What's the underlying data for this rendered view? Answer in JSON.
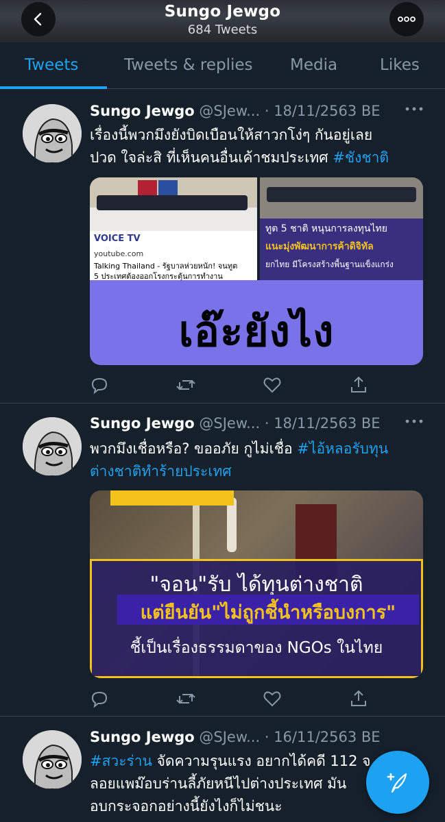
{
  "header": {
    "title": "Sungo Jewgo",
    "subtitle": "684 Tweets"
  },
  "tabs": [
    {
      "label": "Tweets",
      "active": true
    },
    {
      "label": "Tweets & replies",
      "active": false
    },
    {
      "label": "Media",
      "active": false
    },
    {
      "label": "Likes",
      "active": false
    }
  ],
  "tweets": [
    {
      "name": "Sungo Jewgo",
      "handle": "@SJew...",
      "dot": "·",
      "date": "18/11/2563 BE",
      "text_line1": "เรื่องนี้พวกมึงยังบิดเบือนให้สาวกโง่ๆ กันอยู่เลย",
      "text_line2_plain": "ปวด ใจล่ะสิ ที่เห็นคนอื่นเค้าชมประเทศ ",
      "text_line2_hashtag": "#ชังชาติ",
      "media": {
        "yt_domain": "youtube.com",
        "yt_title": "Talking Thailand - รัฐบาลห่วยหนัก! จนทูต",
        "yt_title2": "5 ประเทศต้องออกโรงกระตุ้นการทำงาน",
        "brand": "VOICE TV",
        "overlay_line1": "ทูต 5 ชาติ หนุนการลงทุนไทย",
        "overlay_line2": "แนะมุ่งพัฒนาการค้าดิจิทัล",
        "overlay_line3": "ยกไทย มีโครงสร้างพื้นฐานแข็งแกร่ง",
        "big_text": "เอ๊ะยังไง"
      }
    },
    {
      "name": "Sungo Jewgo",
      "handle": "@SJew...",
      "dot": "·",
      "date": "18/11/2563 BE",
      "text_line1_plain": "พวกมึงเชื่อหรือ? ขออภัย กูไม่เชื่อ ",
      "text_line1_hashtag": "#ไอ้หลอรับทุน",
      "text_line2_hashtag": "ต่างชาติทำร้ายประเทศ",
      "media": {
        "line1": "\"จอน\"รับ ได้ทุนต่างชาติ",
        "line2": "แต่ยืนยัน\"ไม่ถูกชี้นำหรือบงการ\"",
        "line3": "ชี้เป็นเรื่องธรรมดาของ NGOs ในไทย"
      }
    },
    {
      "name": "Sungo Jewgo",
      "handle": "@SJew...",
      "dot": "·",
      "date": "16/11/2563 BE",
      "text_line1_hashtag": "#สวะร่าน",
      "text_line1_plain": " จัดความรุนแรง อยากได้คดี 112 จ",
      "text_line2": "ลอยแพม๊อบร่านลี้ภัยหนีไปต่างประเทศ มัน",
      "text_line3": "อบกระจอกอย่างนี้ยังไงก็ไม่ชนะ"
    }
  ],
  "colors": {
    "background": "#15202b",
    "accent": "#1da1f2",
    "muted": "#8899a6",
    "divider": "#38444d"
  },
  "icons": [
    "back-arrow-icon",
    "more-dots-icon",
    "reply-icon",
    "retweet-icon",
    "like-icon",
    "share-icon",
    "compose-tweet-icon"
  ]
}
